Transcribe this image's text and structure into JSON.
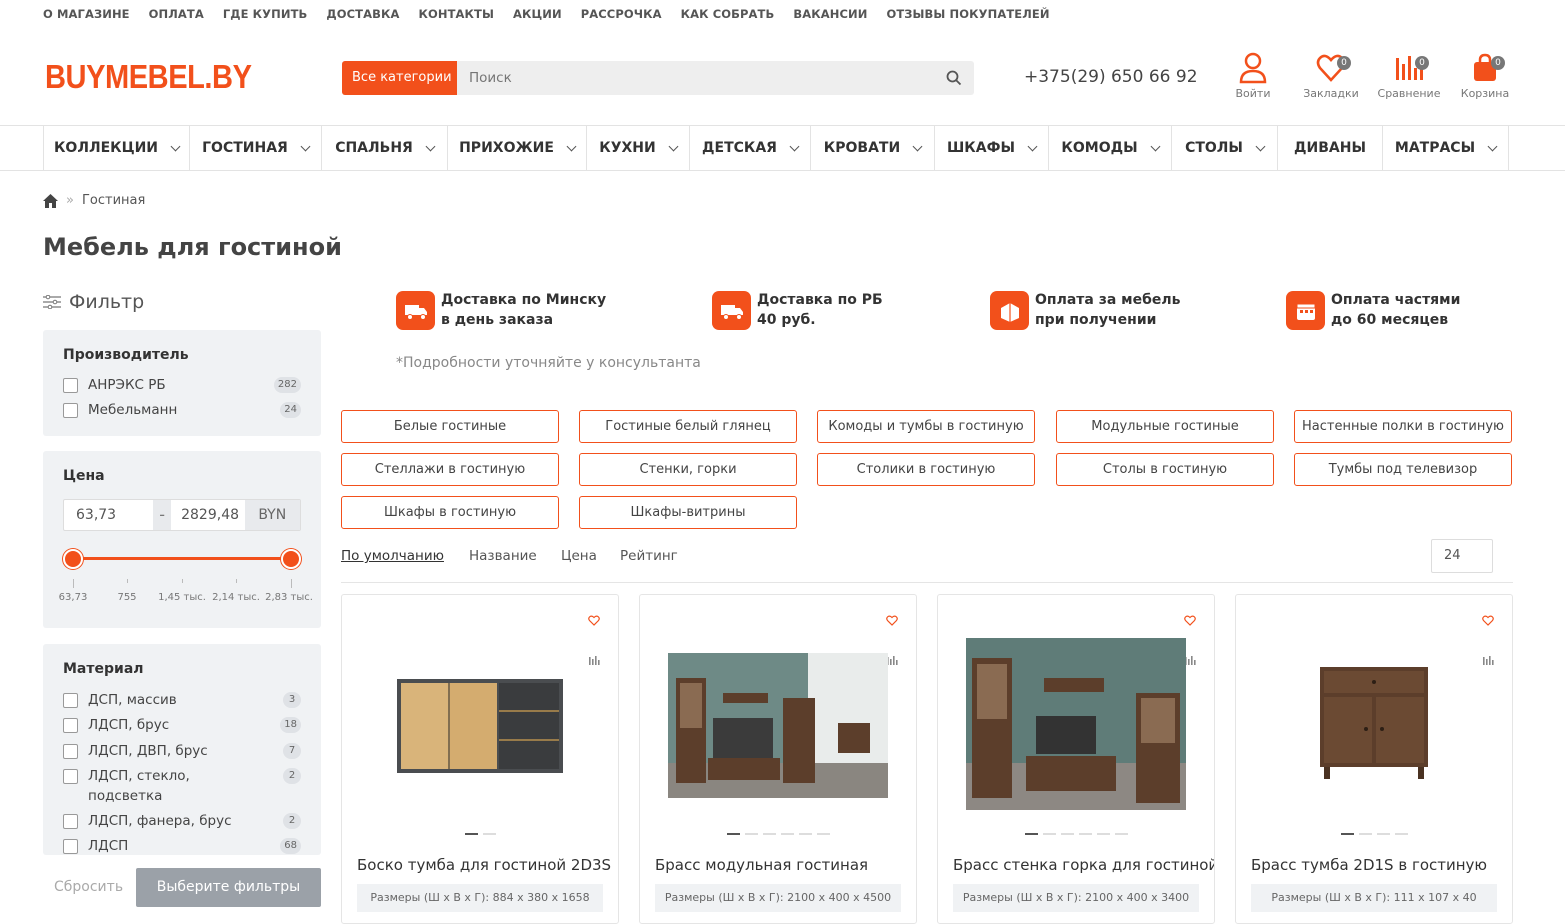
{
  "topnav": [
    "О МАГАЗИНЕ",
    "ОПЛАТА",
    "ГДЕ КУПИТЬ",
    "ДОСТАВКА",
    "КОНТАКТЫ",
    "АКЦИИ",
    "РАССРОЧКА",
    "КАК СОБРАТЬ",
    "ВАКАНСИИ",
    "ОТЗЫВЫ ПОКУПАТЕЛЕЙ"
  ],
  "logo": "BUYMEBEL.BY",
  "search": {
    "category": "Все категории",
    "placeholder": "Поиск"
  },
  "phone": "+375(29) 650 66 92",
  "header_icons": {
    "login": "Войти",
    "bookmarks": {
      "label": "Закладки",
      "count": "0"
    },
    "compare": {
      "label": "Сравнение",
      "count": "0"
    },
    "cart": {
      "label": "Корзина",
      "count": "0"
    }
  },
  "mainnav": [
    {
      "label": "КОЛЛЕКЦИИ",
      "dropdown": true
    },
    {
      "label": "ГОСТИНАЯ",
      "dropdown": true
    },
    {
      "label": "СПАЛЬНЯ",
      "dropdown": true
    },
    {
      "label": "ПРИХОЖИЕ",
      "dropdown": true
    },
    {
      "label": "КУХНИ",
      "dropdown": true
    },
    {
      "label": "ДЕТСКАЯ",
      "dropdown": true
    },
    {
      "label": "КРОВАТИ",
      "dropdown": true
    },
    {
      "label": "ШКАФЫ",
      "dropdown": true
    },
    {
      "label": "КОМОДЫ",
      "dropdown": true
    },
    {
      "label": "СТОЛЫ",
      "dropdown": true
    },
    {
      "label": "ДИВАНЫ",
      "dropdown": false
    },
    {
      "label": "МАТРАСЫ",
      "dropdown": true
    }
  ],
  "breadcrumb": {
    "current": "Гостиная"
  },
  "page_title": "Мебель для гостиной",
  "filter": {
    "title": "Фильтр",
    "manufacturer": {
      "title": "Производитель",
      "items": [
        {
          "label": "АНРЭКС РБ",
          "count": "282"
        },
        {
          "label": "Мебельманн",
          "count": "24"
        }
      ]
    },
    "price": {
      "title": "Цена",
      "min": "63,73",
      "max": "2829,48",
      "currency": "BYN",
      "dash": "-",
      "ticks": [
        "63,73",
        "755",
        "1,45 тыс.",
        "2,14 тыс.",
        "2,83 тыс."
      ]
    },
    "material": {
      "title": "Материал",
      "items": [
        {
          "label": "ДСП, массив",
          "count": "3"
        },
        {
          "label": "ЛДСП, брус",
          "count": "18"
        },
        {
          "label": "ЛДСП, ДВП, брус",
          "count": "7"
        },
        {
          "label": "ЛДСП, стекло, подсветка",
          "count": "2"
        },
        {
          "label": "ЛДСП, фанера, брус",
          "count": "2"
        },
        {
          "label": "ЛДСП",
          "count": "68"
        }
      ]
    },
    "reset": "Сбросить",
    "apply": "Выберите фильтры"
  },
  "perks": [
    {
      "line1": "Доставка по Минску",
      "line2": "в день заказа"
    },
    {
      "line1": "Доставка по РБ",
      "line2": "40 руб."
    },
    {
      "line1": "Оплата за мебель",
      "line2": "при получении"
    },
    {
      "line1": "Оплата частями",
      "line2": "до 60 месяцев"
    }
  ],
  "perks_note": "*Подробности уточняйте у консультанта",
  "tags": [
    "Белые гостиные",
    "Гостиные белый глянец",
    "Комоды и тумбы в гостиную",
    "Модульные гостиные",
    "Настенные полки в гостиную",
    "Стеллажи в гостиную",
    "Стенки, горки",
    "Столики в гостиную",
    "Столы в гостиную",
    "Тумбы под телевизор",
    "Шкафы в гостиную",
    "Шкафы-витрины"
  ],
  "sort": {
    "options": [
      "По умолчанию",
      "Название",
      "Цена",
      "Рейтинг"
    ],
    "per_page": "24"
  },
  "products": [
    {
      "name": "Боско тумба для гостиной 2D3S",
      "dims": "Размеры (Ш х В х Г): 884 х 380 х 1658",
      "dots": 2
    },
    {
      "name": "Брасс модульная гостиная",
      "dims": "Размеры (Ш х В х Г): 2100 х 400 х 4500",
      "dots": 6
    },
    {
      "name": "Брасс стенка горка для гостиной",
      "dims": "Размеры (Ш х В х Г): 2100 х 400 х 3400",
      "dots": 6
    },
    {
      "name": "Брасс тумба 2D1S в гостиную",
      "dims": "Размеры (Ш х В х Г): 111 х 107 х 40",
      "dots": 4
    }
  ],
  "colors": {
    "accent": "#f2501b",
    "panel": "#f0f2f4",
    "button_disabled": "#9ba1a8"
  }
}
